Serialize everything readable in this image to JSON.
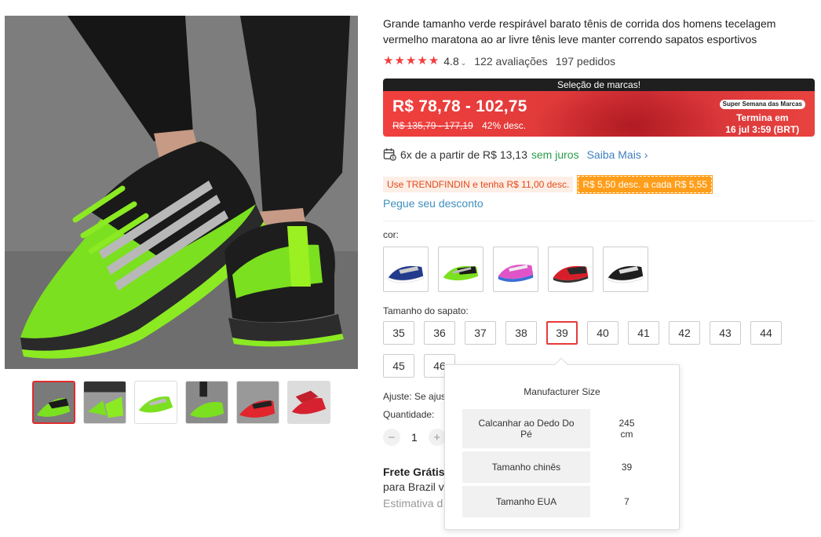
{
  "product": {
    "title": "Grande tamanho verde respirável barato tênis de corrida dos homens tecelagem vermelho maratona ao ar livre tênis leve manter correndo sapatos esportivos",
    "rating": "4.8",
    "reviews": "122 avaliações",
    "orders": "197 pedidos",
    "stars": 5
  },
  "price": {
    "banner": "Seleção de marcas!",
    "current": "R$ 78,78 - 102,75",
    "original": "R$ 135,79 - 177,19",
    "discount": "42% desc.",
    "promo_badge": "Super Semana das Marcas",
    "ends_label": "Termina em",
    "ends_time": "16 jul 3:59 (BRT)"
  },
  "installments": {
    "text": "6x de a partir de R$ 13,13",
    "no_interest": "sem juros",
    "learn_more": "Saiba Mais",
    "learn_more_icon": "chevron-right"
  },
  "coupons": {
    "coupon1": "Use TRENDFINDIN e tenha R$ 11,00 desc.",
    "coupon2": "R$ 5,50 desc. a cada R$ 5,55",
    "get_discount": "Pegue seu desconto"
  },
  "color": {
    "label": "cor:",
    "options": [
      "blue",
      "green",
      "pink",
      "red",
      "black"
    ]
  },
  "size": {
    "label": "Tamanho do sapato:",
    "options": [
      "35",
      "36",
      "37",
      "38",
      "39",
      "40",
      "41",
      "42",
      "43",
      "44",
      "45",
      "46"
    ],
    "selected": "39"
  },
  "adjust": {
    "label": "Ajuste: Se ajus"
  },
  "quantity": {
    "label": "Quantidade:",
    "value": "1",
    "minus": "−",
    "plus": "+"
  },
  "shipping": {
    "title": "Frete Grátis",
    "destination": "para Brazil v",
    "estimate": "Estimativa d"
  },
  "size_popup": {
    "title": "Manufacturer Size",
    "rows": [
      {
        "key": "Calcanhar ao Dedo Do Pé",
        "value": "245 cm"
      },
      {
        "key": "Tamanho chinês",
        "value": "39"
      },
      {
        "key": "Tamanho EUA",
        "value": "7"
      }
    ]
  },
  "colors": {
    "accent_red": "#e83a3a",
    "star_red": "#f33d3d",
    "link_blue": "#3f7fbf",
    "green": "#2a9d4a",
    "coupon_orange": "#ff9e1a"
  }
}
